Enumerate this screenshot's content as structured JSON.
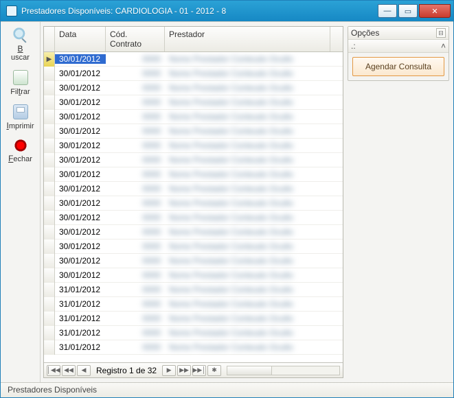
{
  "title": "Prestadores Disponíveis: CARDIOLOGIA - 01 - 2012 - 8",
  "toolbar": {
    "buscar": "Buscar",
    "filtrar": "Filtrar",
    "imprimir": "Imprimir",
    "fechar": "Fechar"
  },
  "grid": {
    "headers": {
      "data": "Data",
      "cod": "Cód. Contrato",
      "prestador": "Prestador"
    },
    "rows": [
      {
        "data": "30/01/2012",
        "selected": true
      },
      {
        "data": "30/01/2012"
      },
      {
        "data": "30/01/2012"
      },
      {
        "data": "30/01/2012"
      },
      {
        "data": "30/01/2012"
      },
      {
        "data": "30/01/2012"
      },
      {
        "data": "30/01/2012"
      },
      {
        "data": "30/01/2012"
      },
      {
        "data": "30/01/2012"
      },
      {
        "data": "30/01/2012"
      },
      {
        "data": "30/01/2012"
      },
      {
        "data": "30/01/2012"
      },
      {
        "data": "30/01/2012"
      },
      {
        "data": "30/01/2012"
      },
      {
        "data": "30/01/2012"
      },
      {
        "data": "30/01/2012"
      },
      {
        "data": "31/01/2012"
      },
      {
        "data": "31/01/2012"
      },
      {
        "data": "31/01/2012"
      },
      {
        "data": "31/01/2012"
      },
      {
        "data": "31/01/2012"
      }
    ]
  },
  "pager": {
    "label": "Registro 1 de 32"
  },
  "options": {
    "title": "Opções",
    "sub": ".:",
    "action": "Agendar Consulta"
  },
  "status": "Prestadores Disponíveis"
}
